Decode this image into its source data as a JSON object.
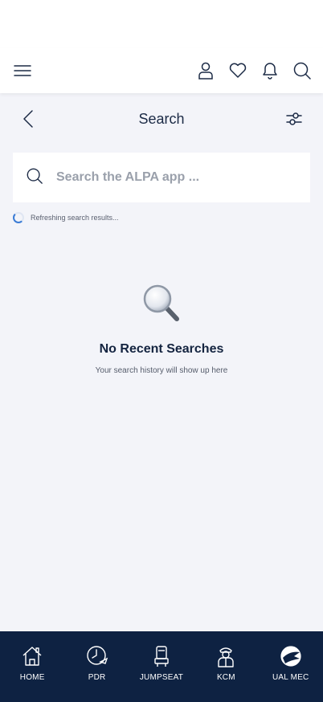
{
  "header": {
    "icons": [
      "menu-icon",
      "user-icon",
      "heart-icon",
      "bell-icon",
      "search-icon"
    ]
  },
  "page": {
    "title": "Search",
    "back_icon": "chevron-left-icon",
    "filter_icon": "sliders-icon"
  },
  "search": {
    "placeholder": "Search the ALPA app ...",
    "value": ""
  },
  "status": {
    "refresh_text": "Refreshing search results..."
  },
  "empty_state": {
    "icon": "magnifier-icon",
    "title": "No Recent Searches",
    "subtitle": "Your search history will show up here"
  },
  "bottom_nav": {
    "items": [
      {
        "label": "HOME",
        "icon": "home-icon"
      },
      {
        "label": "PDR",
        "icon": "clock-plane-icon"
      },
      {
        "label": "JUMPSEAT",
        "icon": "seat-icon"
      },
      {
        "label": "KCM",
        "icon": "pilot-icon"
      },
      {
        "label": "UAL MEC",
        "icon": "ual-logo-icon"
      }
    ]
  },
  "colors": {
    "background": "#f3f4f9",
    "nav_background": "#0e2242",
    "text_primary": "#1b2a45",
    "placeholder": "#9aa0ab",
    "spinner_accent": "#3a7bd5"
  }
}
